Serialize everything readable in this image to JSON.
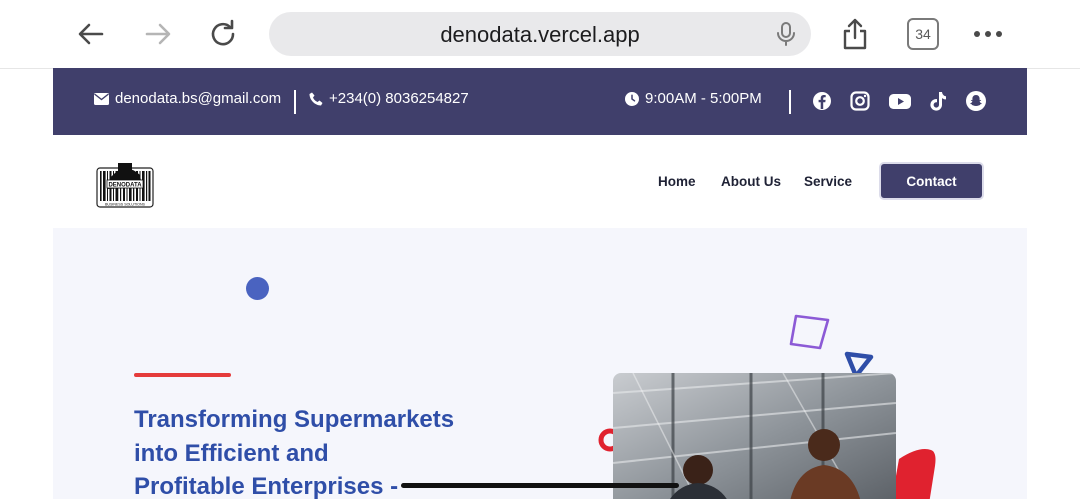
{
  "browser": {
    "url": "denodata.vercel.app",
    "tab_count": "34"
  },
  "topbar": {
    "email": "denodata.bs@gmail.com",
    "phone": "+234(0) 8036254827",
    "hours": "9:00AM - 5:00PM",
    "socials": [
      "facebook-icon",
      "instagram-icon",
      "youtube-icon",
      "tiktok-icon",
      "snapchat-icon"
    ]
  },
  "nav": {
    "logo_text": "DENODATA",
    "logo_subtext": "BUSINESS SOLUTIONS",
    "links": [
      "Home",
      "About Us",
      "Service"
    ],
    "contact_label": "Contact"
  },
  "hero": {
    "title_line1": "Transforming Supermarkets",
    "title_line2": "into Efficient and",
    "title_line3": "Profitable Enterprises -"
  },
  "colors": {
    "brand": "#403f6b",
    "accent_blue": "#2f4ea8",
    "accent_red": "#e53b3b"
  }
}
